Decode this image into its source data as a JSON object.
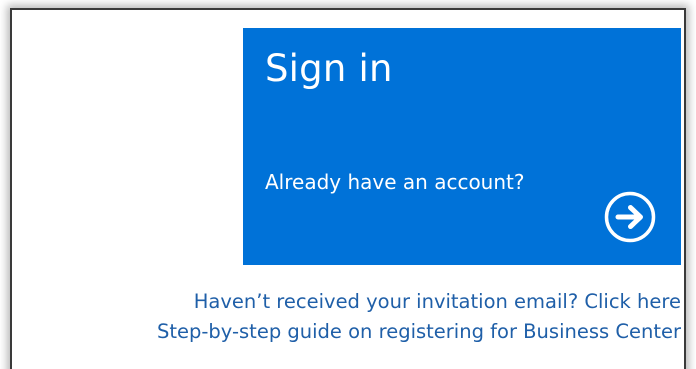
{
  "signin_tile": {
    "title": "Sign in",
    "subtitle": "Already have an account?",
    "arrow_icon": "circle-arrow-right-icon",
    "background_color": "#0072d8",
    "text_color": "#ffffff"
  },
  "links": {
    "invitation_label": "Haven’t received your invitation email? Click here",
    "guide_label": "Step-by-step guide on registering for Business Center",
    "color": "#1f5fa8"
  }
}
